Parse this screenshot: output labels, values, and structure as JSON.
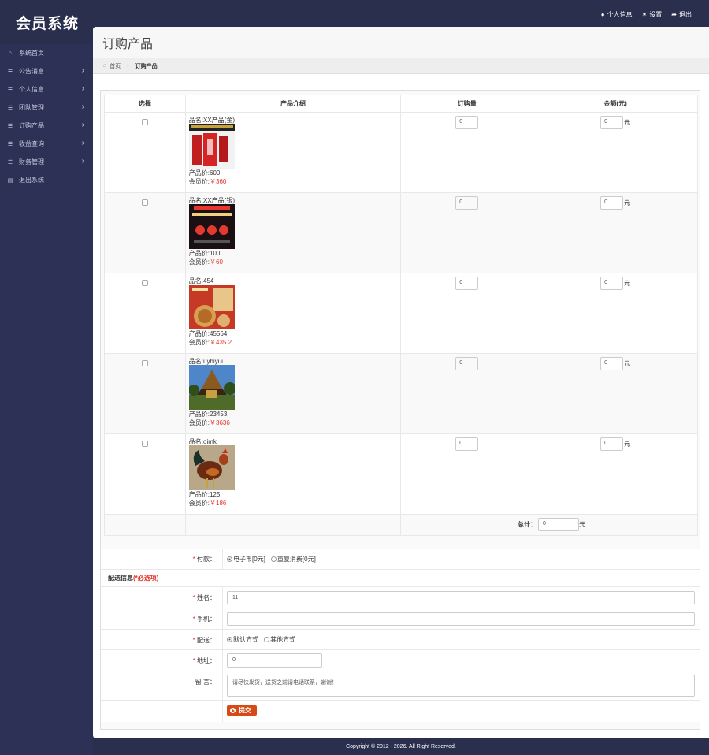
{
  "brand": "会员系统",
  "toplinks": [
    {
      "icon": "user-icon",
      "label": "个人信息"
    },
    {
      "icon": "gear-icon",
      "label": "设置"
    },
    {
      "icon": "logout-icon",
      "label": "退出"
    }
  ],
  "sidebar": {
    "items": [
      {
        "icon": "home-icon",
        "label": "系统首页",
        "chevron": false
      },
      {
        "icon": "list-icon",
        "label": "公告消息",
        "chevron": true
      },
      {
        "icon": "list-icon",
        "label": "个人信息",
        "chevron": true
      },
      {
        "icon": "list-icon",
        "label": "团队管理",
        "chevron": true
      },
      {
        "icon": "list-icon",
        "label": "订购产品",
        "chevron": true
      },
      {
        "icon": "list-icon",
        "label": "收益查询",
        "chevron": true
      },
      {
        "icon": "list-icon",
        "label": "财务管理",
        "chevron": true
      },
      {
        "icon": "exit-icon",
        "label": "退出系统",
        "chevron": false
      }
    ]
  },
  "page": {
    "title": "订购产品",
    "breadcrumb": {
      "home": "首页",
      "current": "订购产品"
    }
  },
  "table": {
    "headers": [
      "选择",
      "产品介绍",
      "订购量",
      "金额(元)"
    ],
    "name_prefix": "品名:",
    "price_prefix": "产品价:",
    "member_prefix": "会员价:",
    "currency": "￥",
    "unit": "元",
    "rows": [
      {
        "name": "XX产品(金)",
        "price": "600",
        "member_price": "360",
        "qty": "0",
        "amount": "0",
        "image": "red-promo-product"
      },
      {
        "name": "XX产品(银)",
        "price": "100",
        "member_price": "60",
        "qty": "0",
        "amount": "0",
        "image": "dark-promo-product"
      },
      {
        "name": "454",
        "price": "45564",
        "member_price": "435.2",
        "qty": "0",
        "amount": "0",
        "image": "mooncake-product"
      },
      {
        "name": "uyhiyui",
        "price": "23453",
        "member_price": "3636",
        "qty": "0",
        "amount": "0",
        "image": "temple-photo"
      },
      {
        "name": "oimk",
        "price": "125",
        "member_price": "186",
        "qty": "0",
        "amount": "0",
        "image": "rooster-photo"
      }
    ],
    "total_label": "总计：",
    "total_value": "0"
  },
  "form": {
    "payment_label": "付款：",
    "payment_options": [
      "电子币[0元]",
      "重复消费[0元]"
    ],
    "section_title": "配送信息",
    "section_required": "(*必选项)",
    "name_label": "姓名：",
    "name_value": "11",
    "phone_label": "手机：",
    "phone_value": "",
    "delivery_label": "配送：",
    "delivery_options": [
      "默认方式",
      "其他方式"
    ],
    "address_label": "地址：",
    "address_value": "0",
    "message_label": "留 言：",
    "message_value": "请尽快发货，送货之前请电话联系，谢谢！",
    "submit_label": "提交"
  },
  "footer": "Copyright © 2012 - 2026. All Right Reserved."
}
